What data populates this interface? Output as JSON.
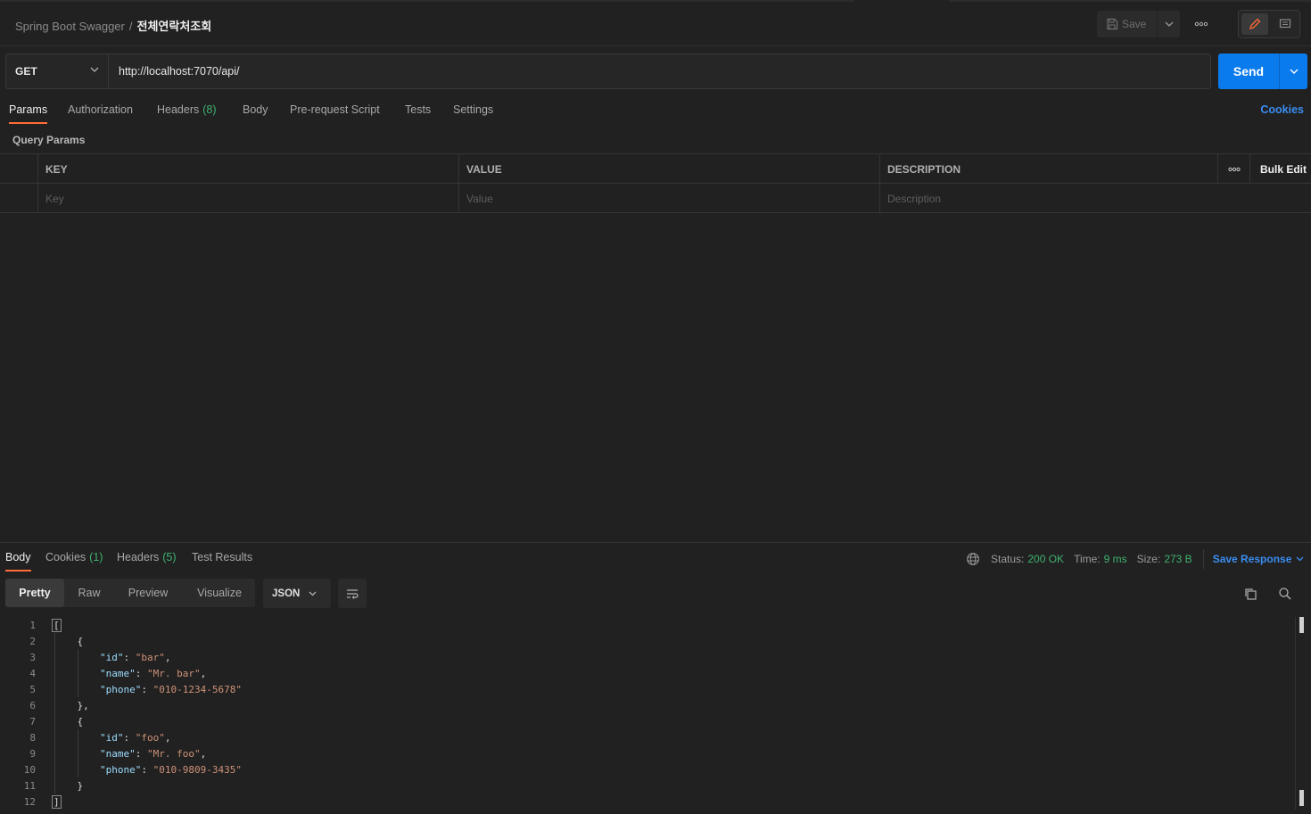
{
  "breadcrumb": {
    "collection": "Spring Boot Swagger",
    "separator": "/",
    "request": "전체연락처조회"
  },
  "toolbar": {
    "save_label": "Save"
  },
  "request": {
    "method": "GET",
    "url": "http://localhost:7070/api/",
    "send_label": "Send"
  },
  "request_tabs": [
    {
      "label": "Params"
    },
    {
      "label": "Authorization"
    },
    {
      "label": "Headers",
      "count": "(8)"
    },
    {
      "label": "Body"
    },
    {
      "label": "Pre-request Script"
    },
    {
      "label": "Tests"
    },
    {
      "label": "Settings"
    }
  ],
  "cookies_link": "Cookies",
  "query_params": {
    "title": "Query Params",
    "headers": [
      "KEY",
      "VALUE",
      "DESCRIPTION"
    ],
    "bulk_edit": "Bulk Edit",
    "placeholders": [
      "Key",
      "Value",
      "Description"
    ]
  },
  "response_tabs": [
    {
      "label": "Body"
    },
    {
      "label": "Cookies",
      "count": "(1)"
    },
    {
      "label": "Headers",
      "count": "(5)"
    },
    {
      "label": "Test Results"
    }
  ],
  "response_status": {
    "status_label": "Status:",
    "status_value": "200 OK",
    "time_label": "Time:",
    "time_value": "9 ms",
    "size_label": "Size:",
    "size_value": "273 B",
    "save_response": "Save Response"
  },
  "view_modes": [
    "Pretty",
    "Raw",
    "Preview",
    "Visualize"
  ],
  "format": "JSON",
  "response_body": [
    {
      "n": "1",
      "code": "["
    },
    {
      "n": "2",
      "code": "    {"
    },
    {
      "n": "3",
      "key": "\"id\"",
      "value": "\"bar\"",
      "trail": ","
    },
    {
      "n": "4",
      "key": "\"name\"",
      "value": "\"Mr. bar\"",
      "trail": ","
    },
    {
      "n": "5",
      "key": "\"phone\"",
      "value": "\"010-1234-5678\"",
      "trail": ""
    },
    {
      "n": "6",
      "code": "    },"
    },
    {
      "n": "7",
      "code": "    {"
    },
    {
      "n": "8",
      "key": "\"id\"",
      "value": "\"foo\"",
      "trail": ","
    },
    {
      "n": "9",
      "key": "\"name\"",
      "value": "\"Mr. foo\"",
      "trail": ","
    },
    {
      "n": "10",
      "key": "\"phone\"",
      "value": "\"010-9809-3435\"",
      "trail": ""
    },
    {
      "n": "11",
      "code": "    }"
    },
    {
      "n": "12",
      "code": "]"
    }
  ],
  "colors": {
    "accent": "#ff6c37",
    "primary": "#097bed",
    "success": "#3fb26f",
    "link": "#3a8df0"
  }
}
